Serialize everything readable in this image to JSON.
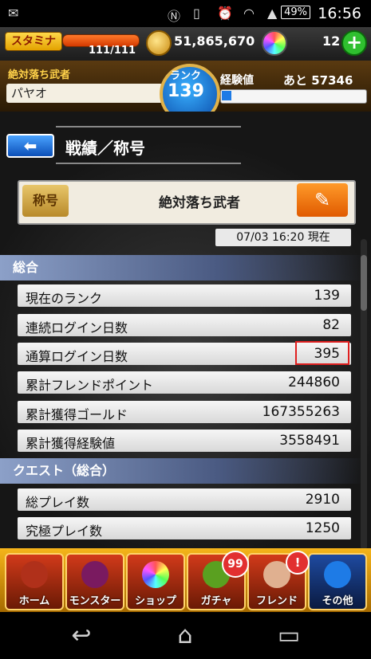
{
  "status": {
    "time": "16:56",
    "battery": "49%",
    "icons": [
      "mail-icon",
      "nfc-icon",
      "vibrate-icon",
      "alarm-icon",
      "wifi-icon",
      "signal-icon"
    ]
  },
  "header": {
    "stamina_label": "スタミナ",
    "stamina": "111/111",
    "stamina_fraction": 1.0,
    "gold": "51,865,670",
    "orbs": "12",
    "plus": "+"
  },
  "player": {
    "title_small": "絶対落ち武者",
    "name": "パヤオ",
    "rank_label": "ランク",
    "rank": "139",
    "exp_label": "経験値",
    "exp_rest": "あと 57346",
    "exp_fraction": 0.07
  },
  "page": {
    "back": "⬅",
    "title": "戦績／称号",
    "shogo_badge": "称号",
    "shogo": "絶対落ち武者",
    "edit": "✎",
    "timestamp": "07/03 16:20 現在"
  },
  "sections": [
    {
      "heading": "総合",
      "rows": [
        {
          "label": "現在のランク",
          "value": "139"
        },
        {
          "label": "連続ログイン日数",
          "value": "82"
        },
        {
          "label": "通算ログイン日数",
          "value": "395",
          "highlight": true
        },
        {
          "label": "累計フレンドポイント",
          "value": "244860"
        },
        {
          "label": "累計獲得ゴールド",
          "value": "167355263"
        },
        {
          "label": "累計獲得経験値",
          "value": "3558491"
        }
      ]
    },
    {
      "heading": "クエスト（総合）",
      "rows": [
        {
          "label": "総プレイ数",
          "value": "2910"
        },
        {
          "label": "究極プレイ数",
          "value": "1250"
        }
      ]
    }
  ],
  "menu": {
    "home": "ホーム",
    "monster": "モンスター",
    "shop": "ショップ",
    "gacha": "ガチャ",
    "gacha_badge": "99",
    "friend": "フレンド",
    "friend_badge": "!",
    "other": "その他"
  },
  "nav": {
    "back": "↩",
    "home": "⌂",
    "recent": "▭"
  },
  "colors": {
    "accent_blue": "#1e7be6",
    "highlight_red": "#e02020",
    "menu_gold": "#f5b41a"
  }
}
